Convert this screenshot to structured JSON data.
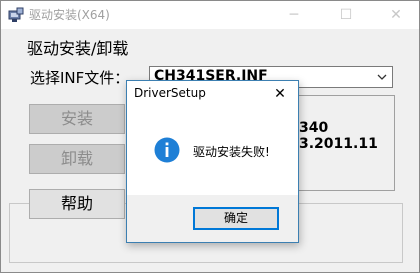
{
  "window": {
    "title": "驱动安装(X64)",
    "minimize_glyph": "─",
    "maximize_glyph": "☐",
    "close_glyph": "✕",
    "app_icon": "driver-setup-icon"
  },
  "main": {
    "group_label": "驱动安装/卸载",
    "inf_label": "选择INF文件：",
    "inf_value": "CH341SER.INF",
    "inf_arrow_icon": "chevron-down-icon",
    "buttons": {
      "install": "安装",
      "uninstall": "卸载",
      "help": "帮助"
    },
    "info_line1": "340",
    "info_line2": "3.2011.11"
  },
  "dialog": {
    "title": "DriverSetup",
    "close_glyph": "✕",
    "icon": "info-icon",
    "icon_glyph": "i",
    "message": "驱动安装失败!",
    "ok_label": "确定",
    "accent_color": "#1e7fd6"
  }
}
